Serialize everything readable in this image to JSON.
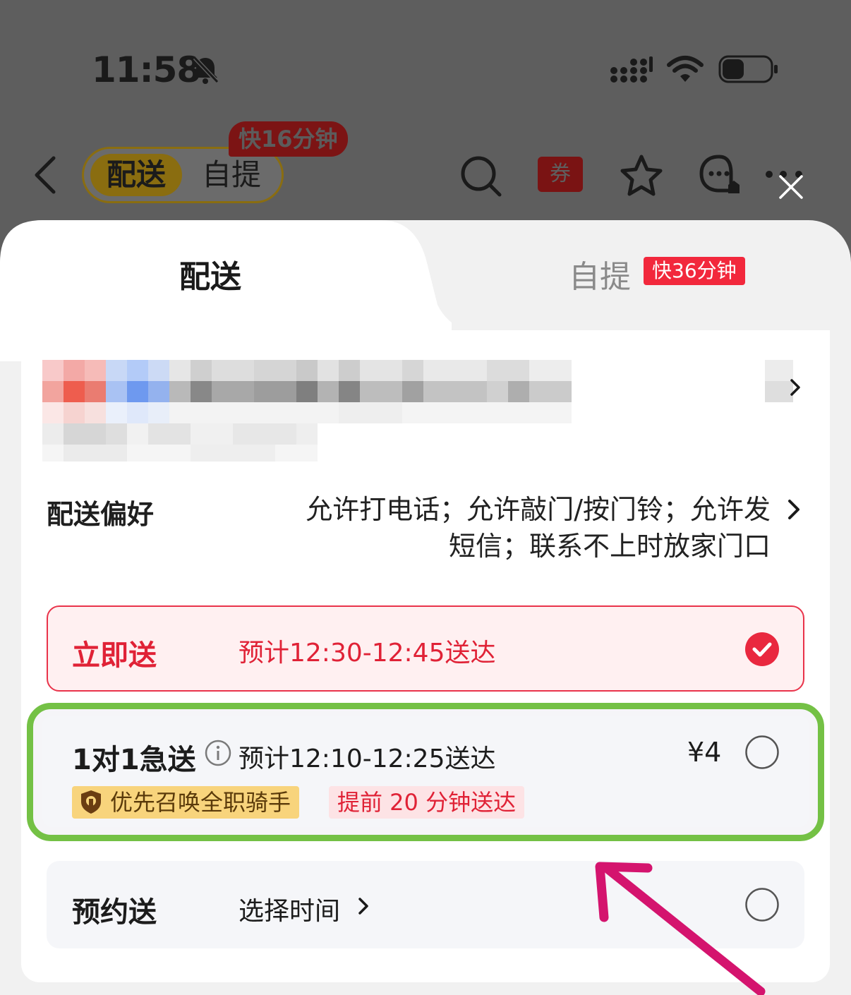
{
  "status_bar": {
    "time": "11:58",
    "icons": [
      "bell-slash-icon",
      "signal-icon",
      "wifi-icon",
      "battery-icon"
    ]
  },
  "top_nav": {
    "segment_active": "配送",
    "segment_inactive": "自提",
    "fast_badge": "快16分钟",
    "coupon_label": "券",
    "icons": [
      "back-icon",
      "search-icon",
      "coupon-icon",
      "star-icon",
      "service-chat-icon",
      "more-icon",
      "close-icon"
    ]
  },
  "sheet": {
    "tab_delivery": "配送",
    "tab_pickup": "自提",
    "tab_pickup_badge": "快36分钟"
  },
  "preference": {
    "label": "配送偏好",
    "value_line1": "允许打电话；允许敲门/按门铃；允许发",
    "value_line2": "短信；联系不上时放家门口"
  },
  "options": {
    "now": {
      "name": "立即送",
      "eta": "预计12:30-12:45送达",
      "selected": true
    },
    "one_to_one": {
      "name": "1对1急送",
      "eta": "预计12:10-12:25送达",
      "price": "¥4",
      "tag_rider": "优先召唤全职骑手",
      "tag_early": "提前 20 分钟送达",
      "selected": false
    },
    "reserve": {
      "name": "预约送",
      "select_label": "选择时间",
      "selected": false
    }
  },
  "colors": {
    "accent_red": "#e02236",
    "highlight_green": "#74c145",
    "annotation_arrow": "#d4146e"
  }
}
